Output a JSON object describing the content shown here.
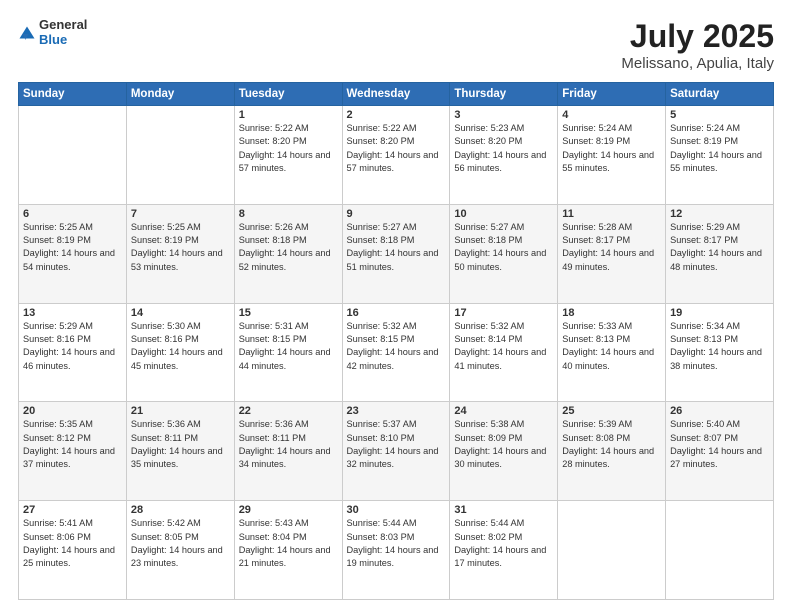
{
  "header": {
    "logo_line1": "General",
    "logo_line2": "Blue",
    "title": "July 2025",
    "subtitle": "Melissano, Apulia, Italy"
  },
  "weekdays": [
    "Sunday",
    "Monday",
    "Tuesday",
    "Wednesday",
    "Thursday",
    "Friday",
    "Saturday"
  ],
  "weeks": [
    [
      {
        "day": "",
        "info": ""
      },
      {
        "day": "",
        "info": ""
      },
      {
        "day": "1",
        "info": "Sunrise: 5:22 AM\nSunset: 8:20 PM\nDaylight: 14 hours and 57 minutes."
      },
      {
        "day": "2",
        "info": "Sunrise: 5:22 AM\nSunset: 8:20 PM\nDaylight: 14 hours and 57 minutes."
      },
      {
        "day": "3",
        "info": "Sunrise: 5:23 AM\nSunset: 8:20 PM\nDaylight: 14 hours and 56 minutes."
      },
      {
        "day": "4",
        "info": "Sunrise: 5:24 AM\nSunset: 8:19 PM\nDaylight: 14 hours and 55 minutes."
      },
      {
        "day": "5",
        "info": "Sunrise: 5:24 AM\nSunset: 8:19 PM\nDaylight: 14 hours and 55 minutes."
      }
    ],
    [
      {
        "day": "6",
        "info": "Sunrise: 5:25 AM\nSunset: 8:19 PM\nDaylight: 14 hours and 54 minutes."
      },
      {
        "day": "7",
        "info": "Sunrise: 5:25 AM\nSunset: 8:19 PM\nDaylight: 14 hours and 53 minutes."
      },
      {
        "day": "8",
        "info": "Sunrise: 5:26 AM\nSunset: 8:18 PM\nDaylight: 14 hours and 52 minutes."
      },
      {
        "day": "9",
        "info": "Sunrise: 5:27 AM\nSunset: 8:18 PM\nDaylight: 14 hours and 51 minutes."
      },
      {
        "day": "10",
        "info": "Sunrise: 5:27 AM\nSunset: 8:18 PM\nDaylight: 14 hours and 50 minutes."
      },
      {
        "day": "11",
        "info": "Sunrise: 5:28 AM\nSunset: 8:17 PM\nDaylight: 14 hours and 49 minutes."
      },
      {
        "day": "12",
        "info": "Sunrise: 5:29 AM\nSunset: 8:17 PM\nDaylight: 14 hours and 48 minutes."
      }
    ],
    [
      {
        "day": "13",
        "info": "Sunrise: 5:29 AM\nSunset: 8:16 PM\nDaylight: 14 hours and 46 minutes."
      },
      {
        "day": "14",
        "info": "Sunrise: 5:30 AM\nSunset: 8:16 PM\nDaylight: 14 hours and 45 minutes."
      },
      {
        "day": "15",
        "info": "Sunrise: 5:31 AM\nSunset: 8:15 PM\nDaylight: 14 hours and 44 minutes."
      },
      {
        "day": "16",
        "info": "Sunrise: 5:32 AM\nSunset: 8:15 PM\nDaylight: 14 hours and 42 minutes."
      },
      {
        "day": "17",
        "info": "Sunrise: 5:32 AM\nSunset: 8:14 PM\nDaylight: 14 hours and 41 minutes."
      },
      {
        "day": "18",
        "info": "Sunrise: 5:33 AM\nSunset: 8:13 PM\nDaylight: 14 hours and 40 minutes."
      },
      {
        "day": "19",
        "info": "Sunrise: 5:34 AM\nSunset: 8:13 PM\nDaylight: 14 hours and 38 minutes."
      }
    ],
    [
      {
        "day": "20",
        "info": "Sunrise: 5:35 AM\nSunset: 8:12 PM\nDaylight: 14 hours and 37 minutes."
      },
      {
        "day": "21",
        "info": "Sunrise: 5:36 AM\nSunset: 8:11 PM\nDaylight: 14 hours and 35 minutes."
      },
      {
        "day": "22",
        "info": "Sunrise: 5:36 AM\nSunset: 8:11 PM\nDaylight: 14 hours and 34 minutes."
      },
      {
        "day": "23",
        "info": "Sunrise: 5:37 AM\nSunset: 8:10 PM\nDaylight: 14 hours and 32 minutes."
      },
      {
        "day": "24",
        "info": "Sunrise: 5:38 AM\nSunset: 8:09 PM\nDaylight: 14 hours and 30 minutes."
      },
      {
        "day": "25",
        "info": "Sunrise: 5:39 AM\nSunset: 8:08 PM\nDaylight: 14 hours and 28 minutes."
      },
      {
        "day": "26",
        "info": "Sunrise: 5:40 AM\nSunset: 8:07 PM\nDaylight: 14 hours and 27 minutes."
      }
    ],
    [
      {
        "day": "27",
        "info": "Sunrise: 5:41 AM\nSunset: 8:06 PM\nDaylight: 14 hours and 25 minutes."
      },
      {
        "day": "28",
        "info": "Sunrise: 5:42 AM\nSunset: 8:05 PM\nDaylight: 14 hours and 23 minutes."
      },
      {
        "day": "29",
        "info": "Sunrise: 5:43 AM\nSunset: 8:04 PM\nDaylight: 14 hours and 21 minutes."
      },
      {
        "day": "30",
        "info": "Sunrise: 5:44 AM\nSunset: 8:03 PM\nDaylight: 14 hours and 19 minutes."
      },
      {
        "day": "31",
        "info": "Sunrise: 5:44 AM\nSunset: 8:02 PM\nDaylight: 14 hours and 17 minutes."
      },
      {
        "day": "",
        "info": ""
      },
      {
        "day": "",
        "info": ""
      }
    ]
  ]
}
